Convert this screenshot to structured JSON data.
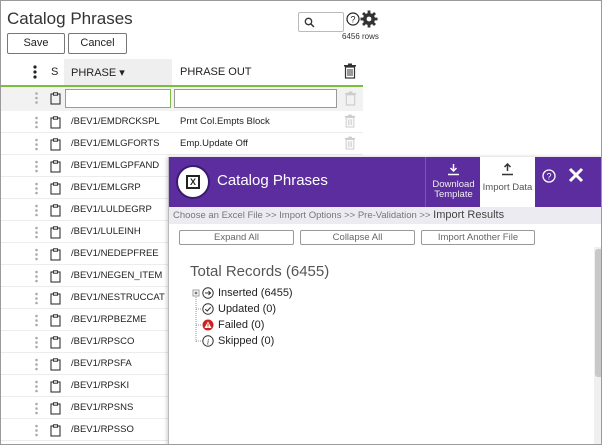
{
  "page": {
    "title": "Catalog Phrases",
    "row_count": "6456 rows"
  },
  "toolbar": {
    "save_label": "Save",
    "cancel_label": "Cancel"
  },
  "grid": {
    "col_s": "S",
    "col_phrase": "PHRASE ▾",
    "col_phrase_out": "PHRASE OUT",
    "rows": [
      {
        "phrase": "/BEV1/EMDRCKSPL",
        "out": "Prnt Col.Empts Block"
      },
      {
        "phrase": "/BEV1/EMLGFORTS",
        "out": "Emp.Update Off"
      },
      {
        "phrase": "/BEV1/EMLGPFAND",
        "out": ""
      },
      {
        "phrase": "/BEV1/EMLGRP",
        "out": ""
      },
      {
        "phrase": "/BEV1/LULDEGRP",
        "out": ""
      },
      {
        "phrase": "/BEV1/LULEINH",
        "out": ""
      },
      {
        "phrase": "/BEV1/NEDEPFREE",
        "out": ""
      },
      {
        "phrase": "/BEV1/NEGEN_ITEM",
        "out": ""
      },
      {
        "phrase": "/BEV1/NESTRUCCAT",
        "out": ""
      },
      {
        "phrase": "/BEV1/RPBEZME",
        "out": ""
      },
      {
        "phrase": "/BEV1/RPSCO",
        "out": ""
      },
      {
        "phrase": "/BEV1/RPSFA",
        "out": ""
      },
      {
        "phrase": "/BEV1/RPSKI",
        "out": ""
      },
      {
        "phrase": "/BEV1/RPSNS",
        "out": ""
      },
      {
        "phrase": "/BEV1/RPSSO",
        "out": ""
      }
    ]
  },
  "modal": {
    "title": "Catalog Phrases",
    "download_line1": "Download",
    "download_line2": "Template",
    "import_label": "Import Data",
    "breadcrumb": "Choose an Excel File >> Import Options >> Pre-Validation >> ",
    "breadcrumb_current": "Import Results",
    "expand_label": "Expand All",
    "collapse_label": "Collapse All",
    "import_another_label": "Import Another File",
    "total": "Total Records (6455)",
    "tree": [
      {
        "label": "Inserted (6455)",
        "icon": "inserted-icon"
      },
      {
        "label": "Updated (0)",
        "icon": "check-circle-icon"
      },
      {
        "label": "Failed (0)",
        "icon": "warning-icon"
      },
      {
        "label": "Skipped (0)",
        "icon": "info-icon"
      }
    ]
  },
  "colors": {
    "accent": "#5b2d9e",
    "grid_underline": "#7cbd3d",
    "failed": "#cc2222"
  }
}
